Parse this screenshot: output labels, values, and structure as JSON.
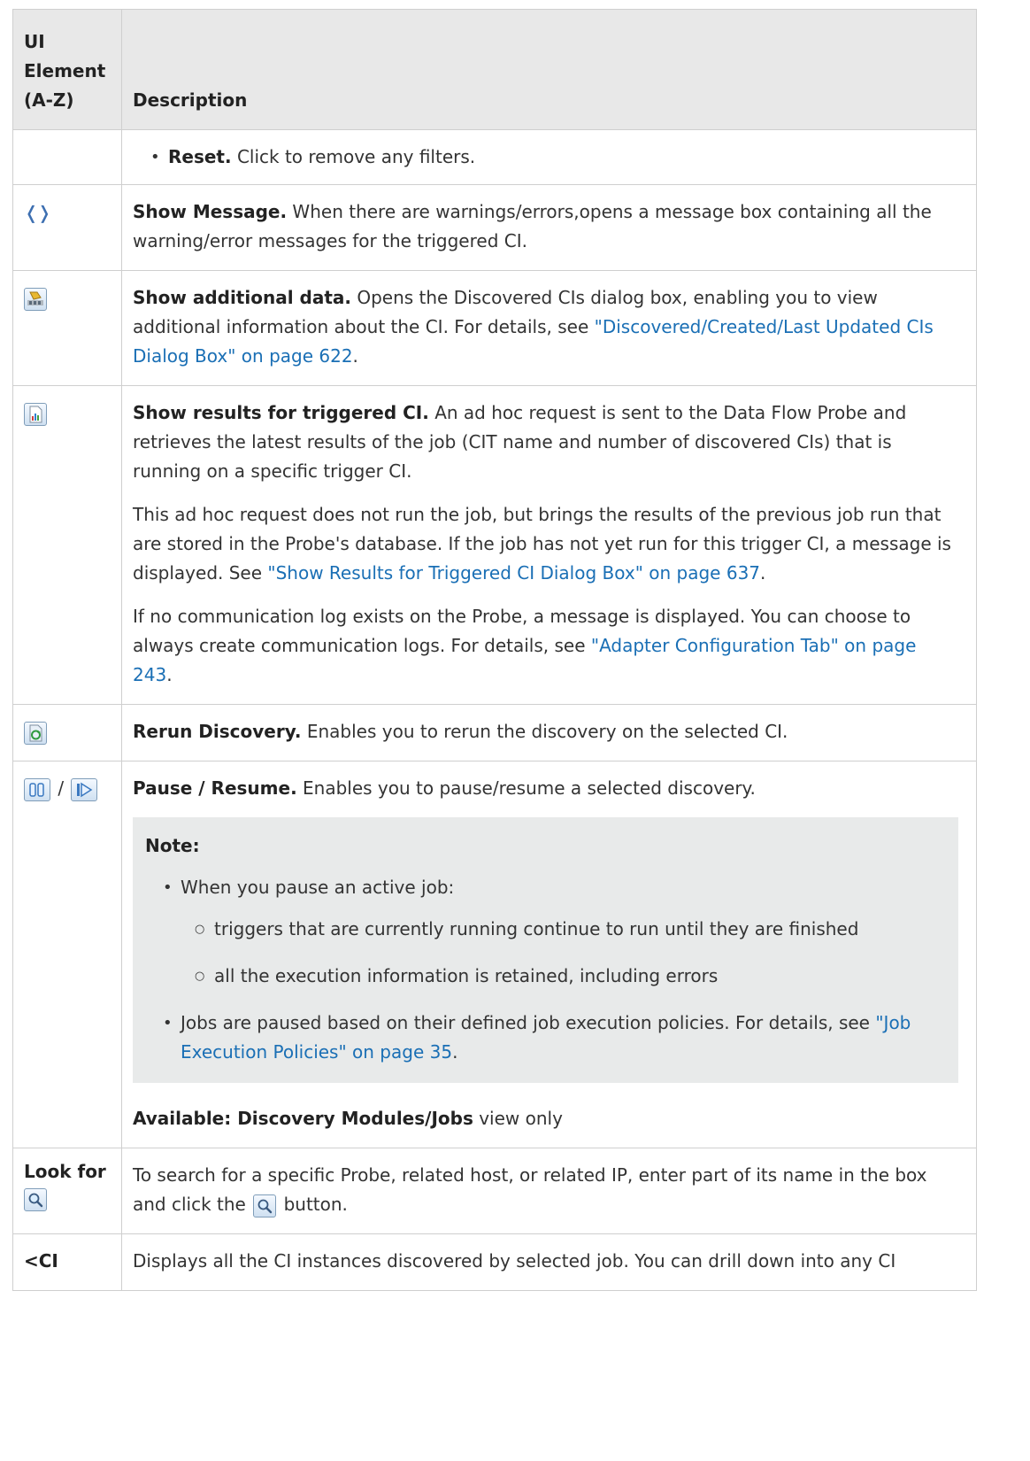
{
  "header": {
    "col1_line1": "UI",
    "col1_line2": "Element",
    "col1_line3": "(A-Z)",
    "col2": "Description"
  },
  "rows": {
    "reset": {
      "title": "Reset.",
      "text": " Click to remove any filters."
    },
    "show_message": {
      "icon": "glasses-icon",
      "title": "Show Message.",
      "text": " When there are warnings/errors,opens a message box containing all the warning/error messages for the triggered CI."
    },
    "show_additional": {
      "icon": "additional-data-icon",
      "title": "Show additional data.",
      "text": " Opens the Discovered CIs dialog box, enabling you to view additional information about the CI. For details, see ",
      "link": "\"Discovered/Created/Last Updated CIs Dialog Box\" on page 622",
      "after": "."
    },
    "show_results": {
      "icon": "results-chart-icon",
      "title": "Show results for triggered CI.",
      "p1_text": " An ad hoc request is sent to the Data Flow Probe and retrieves the latest results of the job (CIT name and number of discovered CIs) that is running on a specific trigger CI.",
      "p2_text": "This ad hoc request does not run the job, but brings the results of the previous job run that are stored in the Probe's database. If the job has not yet run for this trigger CI, a message is displayed. See ",
      "p2_link": "\"Show Results for Triggered CI Dialog Box\" on page 637",
      "p2_after": ".",
      "p3_text": "If no communication log exists on the Probe, a message is displayed. You can choose to always create communication logs. For details, see ",
      "p3_link": "\"Adapter Configuration Tab\" on page 243",
      "p3_after": "."
    },
    "rerun": {
      "icon": "rerun-icon",
      "title": "Rerun Discovery.",
      "text": " Enables you to rerun the discovery on the selected CI."
    },
    "pause": {
      "icon_pause": "pause-icon",
      "separator": "/",
      "icon_resume": "resume-icon",
      "title": "Pause / Resume.",
      "text": " Enables you to pause/resume a selected discovery.",
      "note_title": "Note:",
      "bullet1": "When you pause an active job:",
      "sub1": "triggers that are currently running continue to run until they are finished",
      "sub2": "all the execution information is retained, including errors",
      "bullet2": "Jobs are paused based on their defined job execution policies. For details, see ",
      "bullet2_link": "\"Job Execution Policies\" on page 35",
      "bullet2_after": ".",
      "available_label": "Available: Discovery Modules/Jobs",
      "available_after": " view only"
    },
    "look_for": {
      "label": "Look for",
      "icon": "search-icon",
      "text": "To search for a specific Probe, related host, or related IP, enter part of its name in the box and click the ",
      "text_after": " button."
    },
    "ci": {
      "label": "<CI",
      "text": "Displays all the CI instances discovered by selected job. You can drill down into any CI"
    }
  }
}
